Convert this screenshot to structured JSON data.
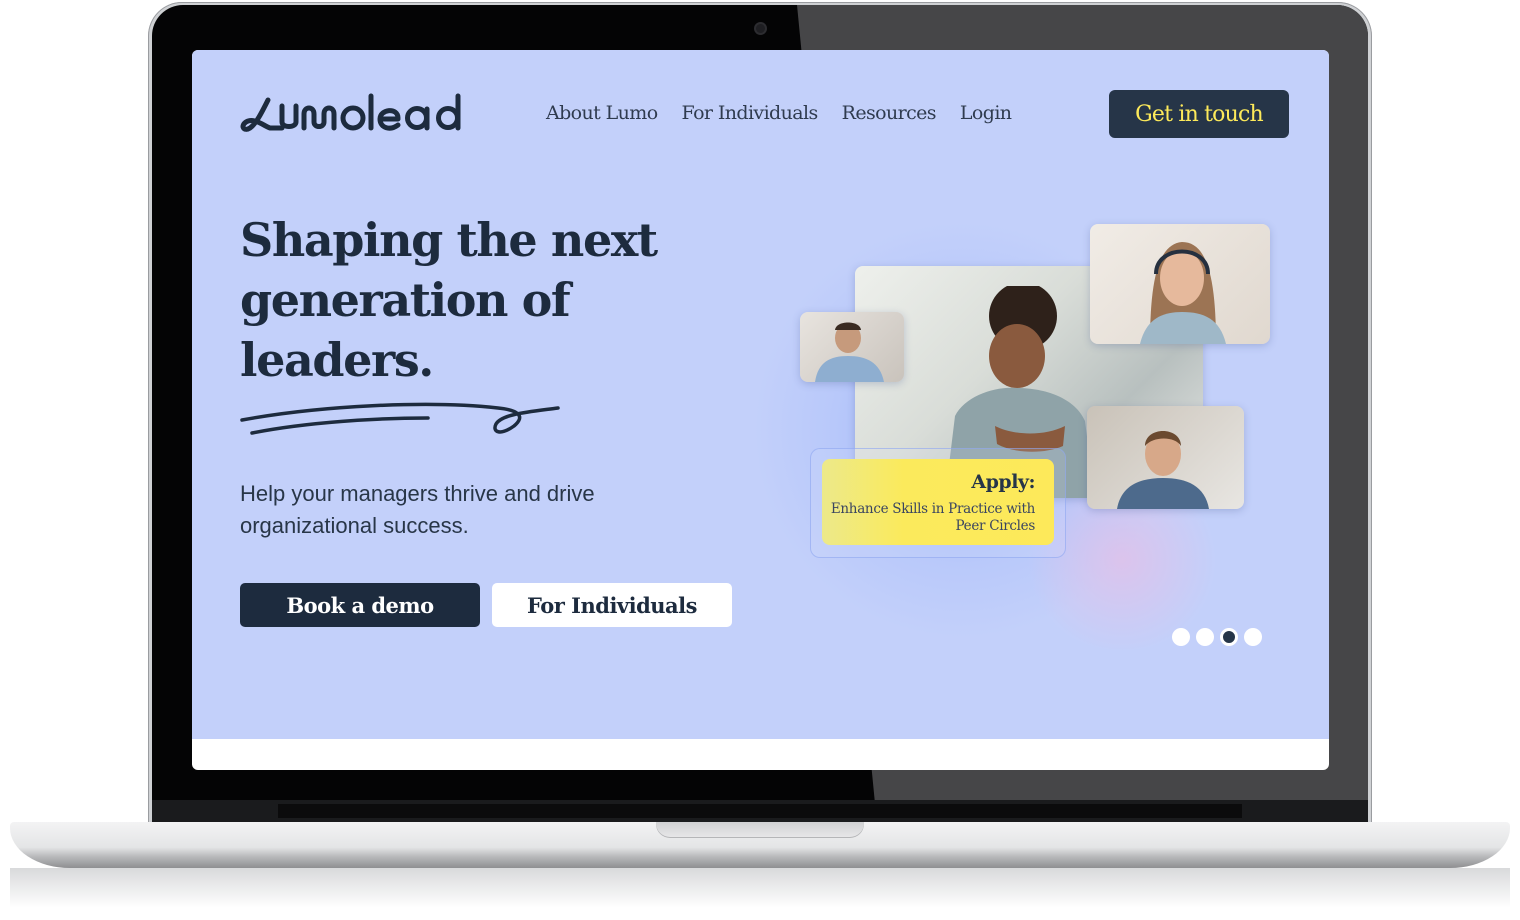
{
  "brand": {
    "name": "Lumolead",
    "accent_dark": "#1d2b3e",
    "accent_yellow": "#fdea5a",
    "hero_bg": "#c3d0fa"
  },
  "nav": {
    "items": [
      {
        "label": "About Lumo"
      },
      {
        "label": "For Individuals"
      },
      {
        "label": "Resources"
      },
      {
        "label": "Login"
      }
    ],
    "cta_label": "Get in touch"
  },
  "hero": {
    "headline": "Shaping the next generation of leaders.",
    "subtitle": "Help your managers thrive and drive organizational success.",
    "primary_button": "Book a demo",
    "secondary_button": "For Individuals"
  },
  "illustration": {
    "caption_title": "Apply:",
    "caption_text": "Enhance Skills in Practice with Peer Circles",
    "tiles": [
      "main-participant-woman",
      "participant-man-left",
      "participant-woman-headset",
      "participant-man-right"
    ]
  },
  "carousel": {
    "total": 4,
    "active_index": 3
  }
}
